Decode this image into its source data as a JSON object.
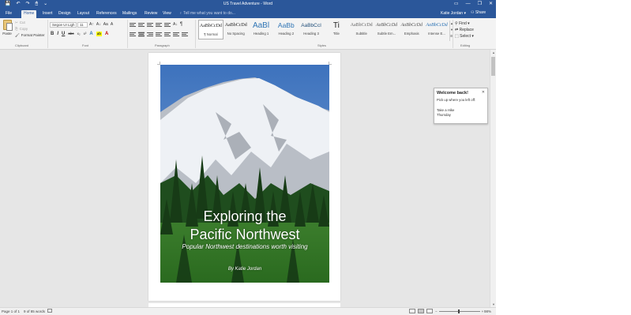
{
  "window": {
    "title": "US Travel Adventure - Word",
    "quick_access": [
      "💾",
      "↶",
      "↷",
      "🖱",
      "⌄"
    ],
    "controls": [
      "▭",
      "—",
      "❐",
      "✕"
    ]
  },
  "tabs": {
    "items": [
      "File",
      "Home",
      "Insert",
      "Design",
      "Layout",
      "References",
      "Mailings",
      "Review",
      "View"
    ],
    "active": "Home",
    "tell_me": "Tell me what you want to do...",
    "user": "Katie Jordan ▾",
    "share": "Share"
  },
  "ribbon": {
    "clipboard": {
      "paste": "Paste",
      "cut": "Cut",
      "copy": "Copy",
      "format_painter": "Format Painter",
      "label": "Clipboard"
    },
    "font": {
      "family": "Segoe UI Ligh",
      "size": "11",
      "grow": "A↑",
      "shrink": "A↓",
      "case": "Aa",
      "clear": "A",
      "bold": "B",
      "italic": "I",
      "underline": "U",
      "strike": "abc",
      "subscript": "x₂",
      "superscript": "x²",
      "effects": "A",
      "highlight": "ab",
      "color": "A",
      "label": "Font"
    },
    "paragraph": {
      "label": "Paragraph",
      "pilcrow": "¶",
      "sort": "A↓"
    },
    "styles": {
      "label": "Styles",
      "items": [
        {
          "preview": "AaBbCcDd",
          "name": "¶ Normal"
        },
        {
          "preview": "AaBbCcDd",
          "name": "No Spacing"
        },
        {
          "preview": "AaBl",
          "name": "Heading 1"
        },
        {
          "preview": "AaBb",
          "name": "Heading 2"
        },
        {
          "preview": "AaBbCcI",
          "name": "Heading 3"
        },
        {
          "preview": "Ti",
          "name": "Title"
        },
        {
          "preview": "AaBbCcDd",
          "name": "Subtitle"
        },
        {
          "preview": "AaBbCcDd",
          "name": "Subtle Em..."
        },
        {
          "preview": "AaBbCcDd",
          "name": "Emphasis"
        },
        {
          "preview": "AaBbCcDd",
          "name": "Intense E..."
        }
      ]
    },
    "editing": {
      "find": "Find ▾",
      "replace": "Replace",
      "select": "Select ▾",
      "label": "Editing"
    }
  },
  "document": {
    "cover": {
      "title_line1": "Exploring the",
      "title_line2": "Pacific Northwest",
      "subtitle": "Popular Northwest destinations worth visiting",
      "author": "By Katie Jordan"
    }
  },
  "welcome_popup": {
    "title": "Welcome back!",
    "subtitle": "Pick up where you left off:",
    "item_line1": "Take a Hike",
    "item_line2": "Thursday",
    "close": "✕"
  },
  "status_bar": {
    "page": "Page 1 of 1",
    "words": "9 of 85 words",
    "zoom": "98%",
    "zoom_level_percent": 98
  },
  "colors": {
    "accent": "#2b579a",
    "sky": "#4a7ec2",
    "forest": "#2e6b2a"
  }
}
